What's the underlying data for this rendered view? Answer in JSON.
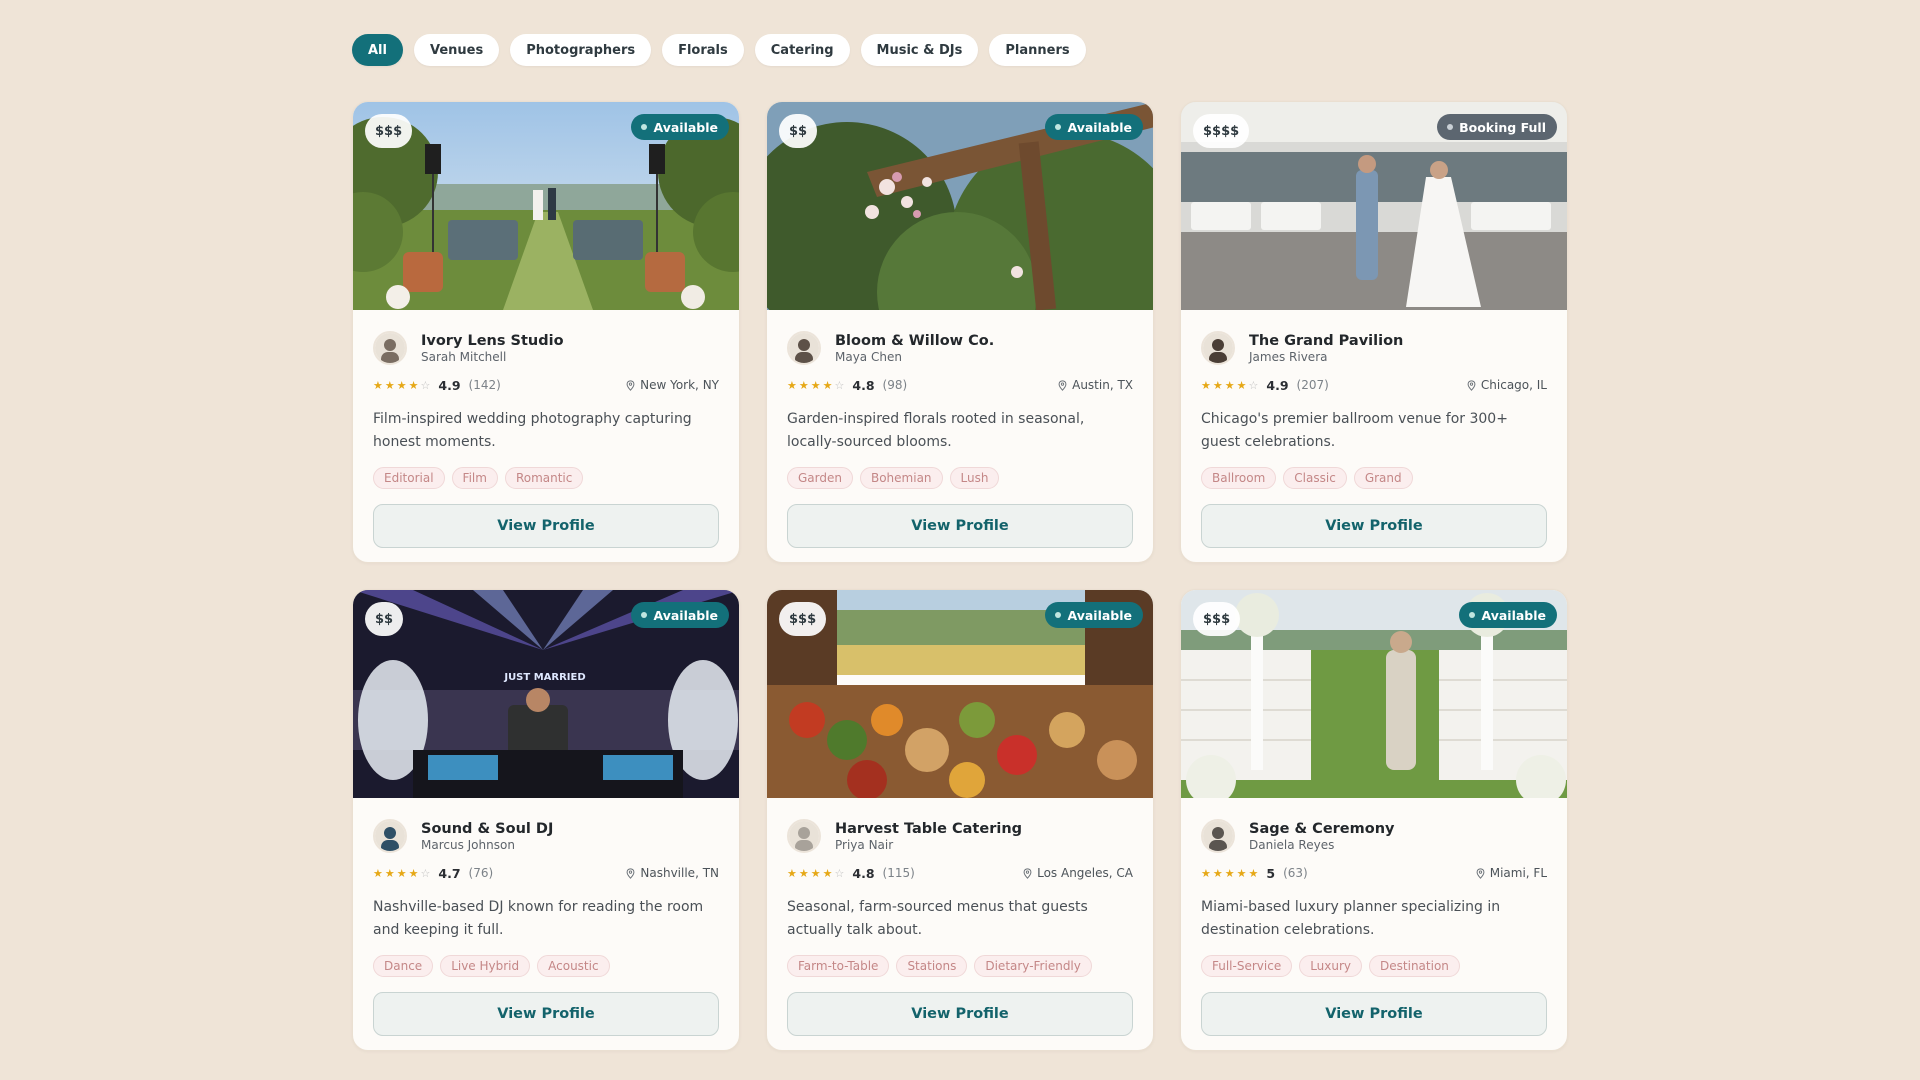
{
  "filters": [
    "All",
    "Venues",
    "Photographers",
    "Florals",
    "Catering",
    "Music & DJs",
    "Planners"
  ],
  "active_filter": "All",
  "colors": {
    "accent": "#13707a",
    "background": "#efe4d7",
    "star": "#e6a817",
    "tag_text": "#c48787",
    "booking_full": "#5c6670"
  },
  "cards": [
    {
      "price": "$$$",
      "status": "Available",
      "name": "Ivory Lens Studio",
      "owner": "Sarah Mitchell",
      "stars": 4,
      "rating": "4.9",
      "reviews": "(142)",
      "location": "New York, NY",
      "description": "Film-inspired wedding photography capturing honest moments.",
      "tags": [
        "Editorial",
        "Film",
        "Romantic"
      ],
      "button": "View Profile",
      "image": "garden-ceremony"
    },
    {
      "price": "$$",
      "status": "Available",
      "name": "Bloom & Willow Co.",
      "owner": "Maya Chen",
      "stars": 4,
      "rating": "4.8",
      "reviews": "(98)",
      "location": "Austin, TX",
      "description": "Garden-inspired florals rooted in seasonal, locally-sourced blooms.",
      "tags": [
        "Garden",
        "Bohemian",
        "Lush"
      ],
      "button": "View Profile",
      "image": "floral-arch"
    },
    {
      "price": "$$$$",
      "status": "Booking Full",
      "name": "The Grand Pavilion",
      "owner": "James Rivera",
      "stars": 4,
      "rating": "4.9",
      "reviews": "(207)",
      "location": "Chicago, IL",
      "description": "Chicago's premier ballroom venue for 300+ guest celebrations.",
      "tags": [
        "Ballroom",
        "Classic",
        "Grand"
      ],
      "button": "View Profile",
      "image": "ballroom-dance"
    },
    {
      "price": "$$",
      "status": "Available",
      "name": "Sound & Soul DJ",
      "owner": "Marcus Johnson",
      "stars": 4,
      "rating": "4.7",
      "reviews": "(76)",
      "location": "Nashville, TN",
      "description": "Nashville-based DJ known for reading the room and keeping it full.",
      "tags": [
        "Dance",
        "Live Hybrid",
        "Acoustic"
      ],
      "button": "View Profile",
      "image": "dj-stage",
      "image_text": "JUST MARRIED"
    },
    {
      "price": "$$$",
      "status": "Available",
      "name": "Harvest Table Catering",
      "owner": "Priya Nair",
      "stars": 4,
      "rating": "4.8",
      "reviews": "(115)",
      "location": "Los Angeles, CA",
      "description": "Seasonal, farm-sourced menus that guests actually talk about.",
      "tags": [
        "Farm-to-Table",
        "Stations",
        "Dietary-Friendly"
      ],
      "button": "View Profile",
      "image": "harvest-table"
    },
    {
      "price": "$$$",
      "status": "Available",
      "name": "Sage & Ceremony",
      "owner": "Daniela Reyes",
      "stars": 5,
      "rating": "5",
      "reviews": "(63)",
      "location": "Miami, FL",
      "description": "Miami-based luxury planner specializing in destination celebrations.",
      "tags": [
        "Full-Service",
        "Luxury",
        "Destination"
      ],
      "button": "View Profile",
      "image": "planner-ceremony"
    }
  ]
}
